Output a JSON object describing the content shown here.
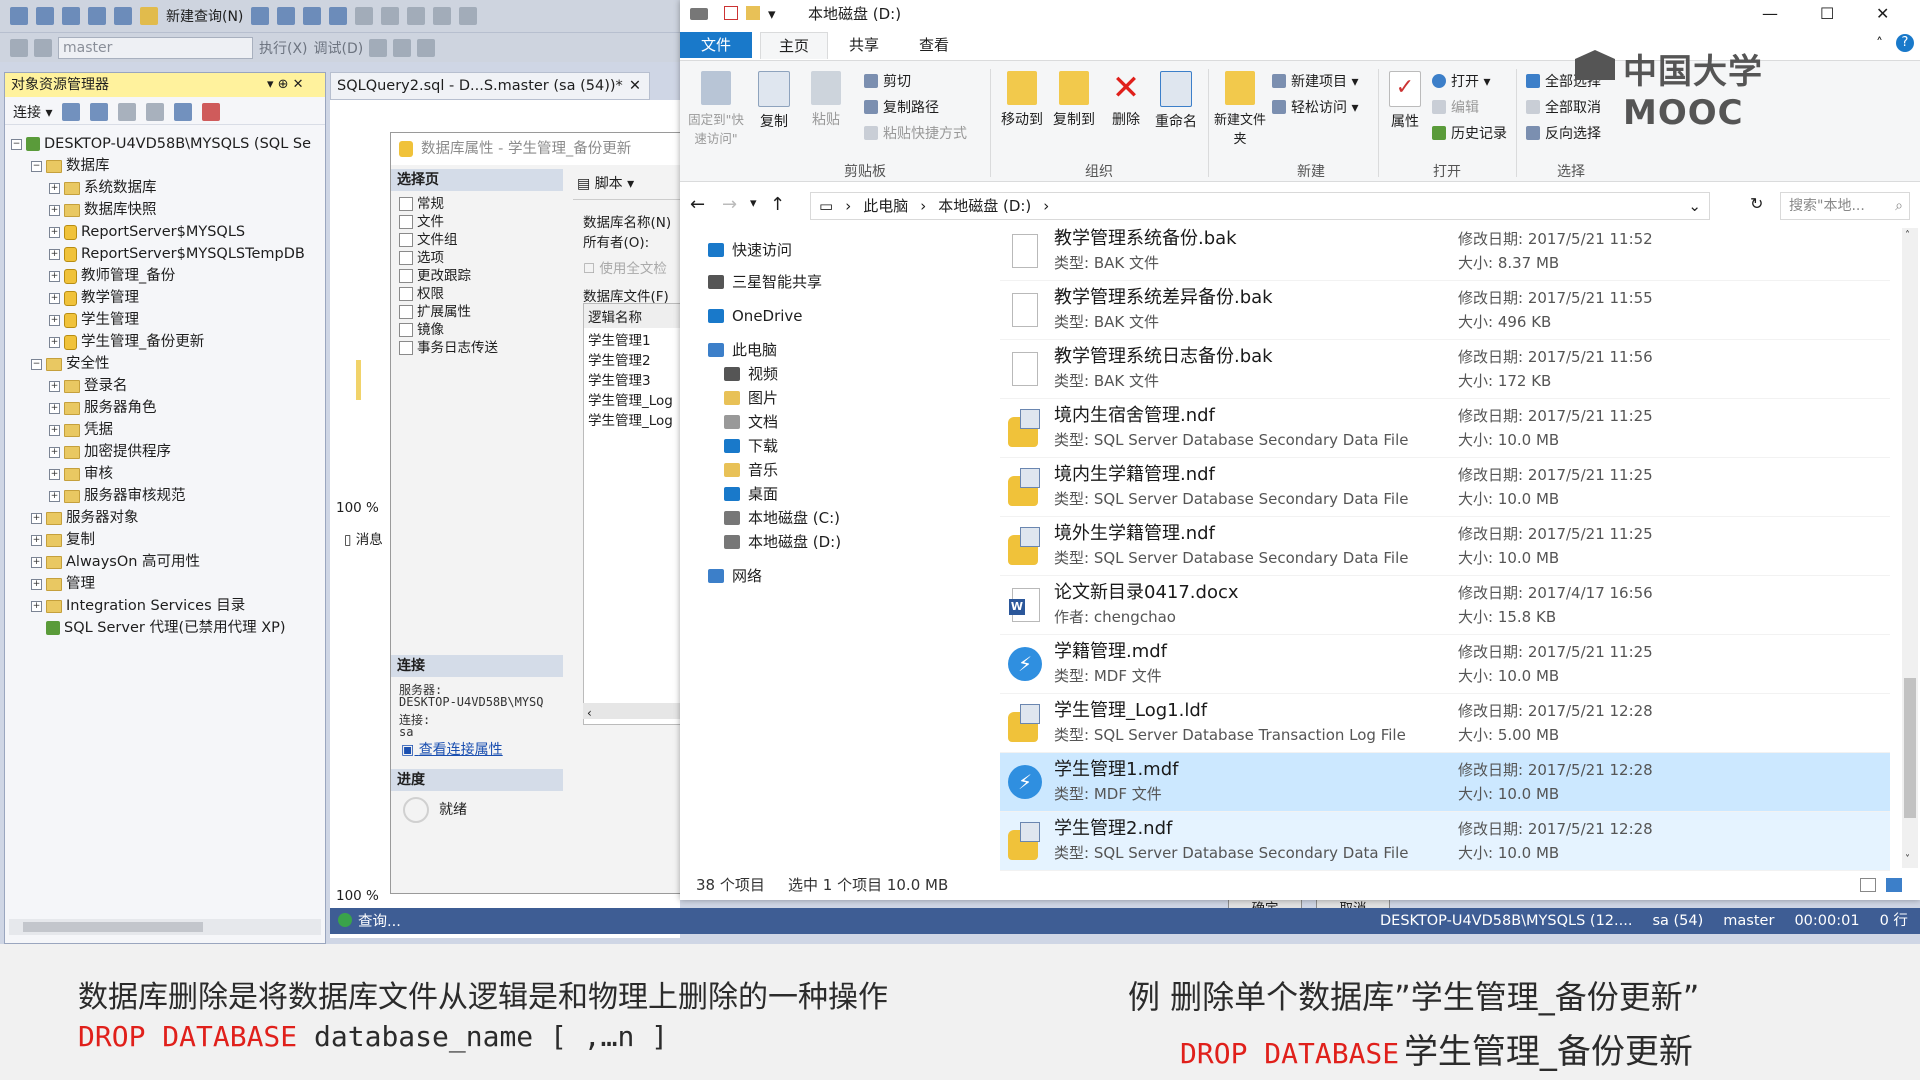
{
  "ssms": {
    "toolbar1": {
      "new_query": "新建查询(N)"
    },
    "toolbar2": {
      "database": "master",
      "execute": "执行(X)",
      "debug": "调试(D)"
    },
    "object_explorer": {
      "title": "对象资源管理器",
      "pin": "▾ ⊕ ✕",
      "connect": "连接 ▾",
      "server_node": "DESKTOP-U4VD58B\\MYSQLS (SQL Se",
      "tree": [
        {
          "label": "数据库",
          "level": 1,
          "exp": "−",
          "kind": "folder"
        },
        {
          "label": "系统数据库",
          "level": 2,
          "exp": "+",
          "kind": "folder"
        },
        {
          "label": "数据库快照",
          "level": 2,
          "exp": "+",
          "kind": "folder"
        },
        {
          "label": "ReportServer$MYSQLS",
          "level": 2,
          "exp": "+",
          "kind": "db"
        },
        {
          "label": "ReportServer$MYSQLSTempDB",
          "level": 2,
          "exp": "+",
          "kind": "db"
        },
        {
          "label": "教师管理_备份",
          "level": 2,
          "exp": "+",
          "kind": "db"
        },
        {
          "label": "教学管理",
          "level": 2,
          "exp": "+",
          "kind": "db"
        },
        {
          "label": "学生管理",
          "level": 2,
          "exp": "+",
          "kind": "db"
        },
        {
          "label": "学生管理_备份更新",
          "level": 2,
          "exp": "+",
          "kind": "db"
        },
        {
          "label": "安全性",
          "level": 1,
          "exp": "−",
          "kind": "folder"
        },
        {
          "label": "登录名",
          "level": 2,
          "exp": "+",
          "kind": "folder"
        },
        {
          "label": "服务器角色",
          "level": 2,
          "exp": "+",
          "kind": "folder"
        },
        {
          "label": "凭据",
          "level": 2,
          "exp": "+",
          "kind": "folder"
        },
        {
          "label": "加密提供程序",
          "level": 2,
          "exp": "+",
          "kind": "folder"
        },
        {
          "label": "审核",
          "level": 2,
          "exp": "+",
          "kind": "folder"
        },
        {
          "label": "服务器审核规范",
          "level": 2,
          "exp": "+",
          "kind": "folder"
        },
        {
          "label": "服务器对象",
          "level": 1,
          "exp": "+",
          "kind": "folder"
        },
        {
          "label": "复制",
          "level": 1,
          "exp": "+",
          "kind": "folder"
        },
        {
          "label": "AlwaysOn 高可用性",
          "level": 1,
          "exp": "+",
          "kind": "folder"
        },
        {
          "label": "管理",
          "level": 1,
          "exp": "+",
          "kind": "folder"
        },
        {
          "label": "Integration Services 目录",
          "level": 1,
          "exp": "+",
          "kind": "folder"
        },
        {
          "label": "SQL Server 代理(已禁用代理 XP)",
          "level": 1,
          "exp": "",
          "kind": "agent"
        }
      ]
    },
    "query_tab": "SQLQuery2.sql - D...S.master (sa (54))*",
    "dialog": {
      "title": "数据库属性 - 学生管理_备份更新",
      "select_page": "选择页",
      "pages": [
        "常规",
        "文件",
        "文件组",
        "选项",
        "更改跟踪",
        "权限",
        "扩展属性",
        "镜像",
        "事务日志传送"
      ],
      "script": "脚本",
      "db_name_label": "数据库名称(N)",
      "owner_label": "所有者(O):",
      "fulltext": "使用全文检",
      "db_files": "数据库文件(F)",
      "logical_name": "逻辑名称",
      "files": [
        "学生管理1",
        "学生管理2",
        "学生管理3",
        "学生管理_Log",
        "学生管理_Log"
      ],
      "connection_hdr": "连接",
      "server_label": "服务器:",
      "server_value": "DESKTOP-U4VD58B\\MYSQ",
      "conn_label": "连接:",
      "conn_value": "sa",
      "view_conn": "查看连接属性",
      "progress_hdr": "进度",
      "ready": "就绪",
      "ok": "确定",
      "cancel": "取消"
    },
    "zoom1": "100 %",
    "zoom2": "100 %",
    "messages": "消息",
    "query_status": "查询...",
    "status": {
      "server": "DESKTOP-U4VD58B\\MYSQLS (12....",
      "user": "sa (54)",
      "db": "master",
      "time": "00:00:01",
      "rows": "0 行"
    }
  },
  "explorer": {
    "title": "本地磁盘 (D:)",
    "tabs": [
      "文件",
      "主页",
      "共享",
      "查看"
    ],
    "ribbon": {
      "pin": "固定到\"快速访问\"",
      "copy": "复制",
      "paste": "粘贴",
      "cut": "剪切",
      "copy_path": "复制路径",
      "paste_shortcut": "粘贴快捷方式",
      "clipboard": "剪贴板",
      "move_to": "移动到",
      "copy_to": "复制到",
      "delete": "删除",
      "rename": "重命名",
      "organize": "组织",
      "new_folder": "新建文件夹",
      "new_item": "新建项目 ▾",
      "easy_access": "轻松访问 ▾",
      "new": "新建",
      "properties": "属性",
      "open": "打开 ▾",
      "edit": "编辑",
      "history": "历史记录",
      "open_group": "打开",
      "select_all": "全部选择",
      "select_none": "全部取消",
      "invert": "反向选择",
      "select_group": "选择"
    },
    "address": {
      "this_pc": "此电脑",
      "drive": "本地磁盘 (D:)"
    },
    "search_placeholder": "搜索\"本地...",
    "nav": [
      {
        "label": "快速访问",
        "indent": 0,
        "icon": "star-icon"
      },
      {
        "label": "三星智能共享",
        "indent": 0,
        "icon": "share-icon"
      },
      {
        "label": "OneDrive",
        "indent": 0,
        "icon": "cloud-icon"
      },
      {
        "label": "此电脑",
        "indent": 0,
        "icon": "computer-icon"
      },
      {
        "label": "视频",
        "indent": 1,
        "icon": "video-icon"
      },
      {
        "label": "图片",
        "indent": 1,
        "icon": "picture-icon"
      },
      {
        "label": "文档",
        "indent": 1,
        "icon": "document-icon"
      },
      {
        "label": "下载",
        "indent": 1,
        "icon": "download-icon"
      },
      {
        "label": "音乐",
        "indent": 1,
        "icon": "music-icon"
      },
      {
        "label": "桌面",
        "indent": 1,
        "icon": "desktop-icon"
      },
      {
        "label": "本地磁盘 (C:)",
        "indent": 1,
        "icon": "drive-icon"
      },
      {
        "label": "本地磁盘 (D:)",
        "indent": 1,
        "icon": "drive-icon"
      },
      {
        "label": "网络",
        "indent": 0,
        "icon": "network-icon"
      }
    ],
    "files": [
      {
        "name": "教学管理系统备份.bak",
        "type": "类型: BAK 文件",
        "date": "修改日期: 2017/5/21 11:52",
        "size": "大小: 8.37 MB",
        "icon": "blank-file-icon"
      },
      {
        "name": "教学管理系统差异备份.bak",
        "type": "类型: BAK 文件",
        "date": "修改日期: 2017/5/21 11:55",
        "size": "大小: 496 KB",
        "icon": "blank-file-icon"
      },
      {
        "name": "教学管理系统日志备份.bak",
        "type": "类型: BAK 文件",
        "date": "修改日期: 2017/5/21 11:56",
        "size": "大小: 172 KB",
        "icon": "blank-file-icon"
      },
      {
        "name": "境内生宿舍管理.ndf",
        "type": "类型: SQL Server Database Secondary Data File",
        "date": "修改日期: 2017/5/21 11:25",
        "size": "大小: 10.0 MB",
        "icon": "sql-data-file-icon"
      },
      {
        "name": "境内生学籍管理.ndf",
        "type": "类型: SQL Server Database Secondary Data File",
        "date": "修改日期: 2017/5/21 11:25",
        "size": "大小: 10.0 MB",
        "icon": "sql-data-file-icon"
      },
      {
        "name": "境外生学籍管理.ndf",
        "type": "类型: SQL Server Database Secondary Data File",
        "date": "修改日期: 2017/5/21 11:25",
        "size": "大小: 10.0 MB",
        "icon": "sql-data-file-icon"
      },
      {
        "name": "论文新目录0417.docx",
        "type": "作者: chengchao",
        "date": "修改日期: 2017/4/17 16:56",
        "size": "大小: 15.8 KB",
        "icon": "word-file-icon"
      },
      {
        "name": "学籍管理.mdf",
        "type": "类型: MDF 文件",
        "date": "修改日期: 2017/5/21 11:25",
        "size": "大小: 10.0 MB",
        "icon": "mdf-file-icon"
      },
      {
        "name": "学生管理_Log1.ldf",
        "type": "类型: SQL Server Database Transaction Log File",
        "date": "修改日期: 2017/5/21 12:28",
        "size": "大小: 5.00 MB",
        "icon": "sql-data-file-icon"
      },
      {
        "name": "学生管理1.mdf",
        "type": "类型: MDF 文件",
        "date": "修改日期: 2017/5/21 12:28",
        "size": "大小: 10.0 MB",
        "icon": "mdf-file-icon",
        "selected": true
      },
      {
        "name": "学生管理2.ndf",
        "type": "类型: SQL Server Database Secondary Data File",
        "date": "修改日期: 2017/5/21 12:28",
        "size": "大小: 10.0 MB",
        "icon": "sql-data-file-icon",
        "hover": true
      }
    ],
    "status": {
      "count": "38 个项目",
      "selected": "选中 1 个项目 10.0 MB"
    }
  },
  "watermark": "中国大学MOOC",
  "caption": {
    "line1": "数据库删除是将数据库文件从逻辑是和物理上删除的一种操作",
    "syntax_kw": "DROP DATABASE",
    "syntax_arg": "database_name [ ,…n ]",
    "example": "例 删除单个数据库”学生管理_备份更新”",
    "example_kw": "DROP DATABASE",
    "example_arg": "学生管理_备份更新"
  }
}
